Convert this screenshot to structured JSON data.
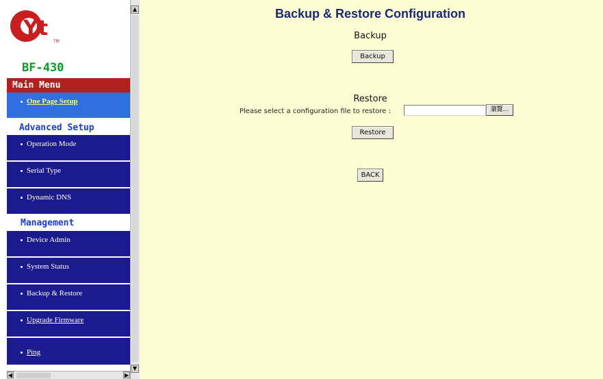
{
  "brand": {
    "logo_text": "Yt",
    "trademark": "TM",
    "model": "BF-430"
  },
  "sidebar": {
    "main_menu": "Main Menu",
    "one_page_setup": "One Page Setup",
    "advanced_setup": "Advanced Setup",
    "advanced_items": [
      {
        "label": "Operation Mode"
      },
      {
        "label": "Serial Type"
      },
      {
        "label": "Dynamic DNS"
      }
    ],
    "management": "Management",
    "management_items": [
      {
        "label": "Device Admin"
      },
      {
        "label": "System Status"
      },
      {
        "label": "Backup & Restore"
      },
      {
        "label": "Upgrade Firmware"
      },
      {
        "label": "Ping"
      }
    ]
  },
  "main": {
    "title": "Backup & Restore Configuration",
    "backup_heading": "Backup",
    "backup_button": "Backup",
    "restore_heading": "Restore",
    "restore_prompt": "Please select a configuration file to restore :",
    "browse_button": "瀏覽...",
    "file_value": "",
    "restore_button": "Restore",
    "back_button": "BACK"
  },
  "colors": {
    "content_bg": "#fdfdd3",
    "menu_red": "#b21f1f",
    "menu_navy": "#1b1b8f",
    "menu_highlight": "#2f6fe0",
    "model_green": "#0a9a2a"
  }
}
